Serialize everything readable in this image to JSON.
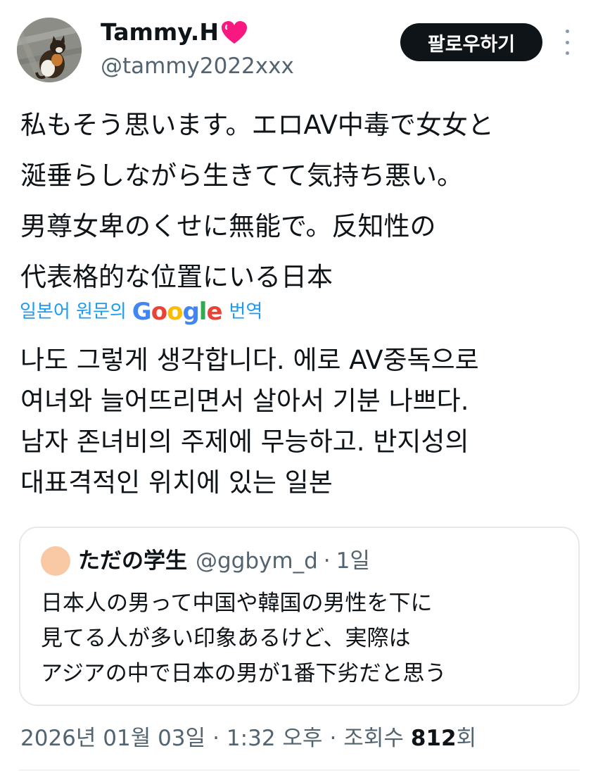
{
  "author": {
    "display_name": "Tammy.H",
    "handle": "@tammy2022xxx",
    "follow_label": "팔로우하기"
  },
  "tweet": {
    "text": "私もそう思います。エロAV中毒で女女と\n涎垂らしながら生きてて気持ち悪い。\n男尊女卑のくせに無能で。反知性の\n代表格的な位置にいる日本",
    "translate_prefix": "일본어 원문의",
    "translate_google": "Google",
    "translate_suffix": "번역",
    "translated_text": "나도 그렇게 생각합니다. 에로 AV중독으로\n여녀와 늘어뜨리면서 살아서 기분 나쁘다.\n남자 존녀비의 주제에 무능하고. 반지성의\n대표격적인 위치에 있는 일본"
  },
  "quoted": {
    "name": "ただの学生",
    "handle": "@ggbym_d",
    "sep": "·",
    "time": "1일",
    "text": "日本人の男って中国や韓国の男性を下に\n見てる人が多い印象あるけど、実際は\nアジアの中で日本の男が1番下劣だと思う"
  },
  "footer": {
    "date": "2026년 01월 03일",
    "sep1": "·",
    "time": "1:32 오후",
    "sep2": "·",
    "views_label": "조회수",
    "views_count": "812",
    "views_suffix": "회"
  },
  "colors": {
    "text": "#0f1419",
    "secondary": "#536471",
    "link": "#1d9bf0",
    "heart": "#f91880",
    "follow_bg": "#0f1419"
  },
  "icons": [
    "heart-icon",
    "more-vertical-icon",
    "google-logo"
  ]
}
